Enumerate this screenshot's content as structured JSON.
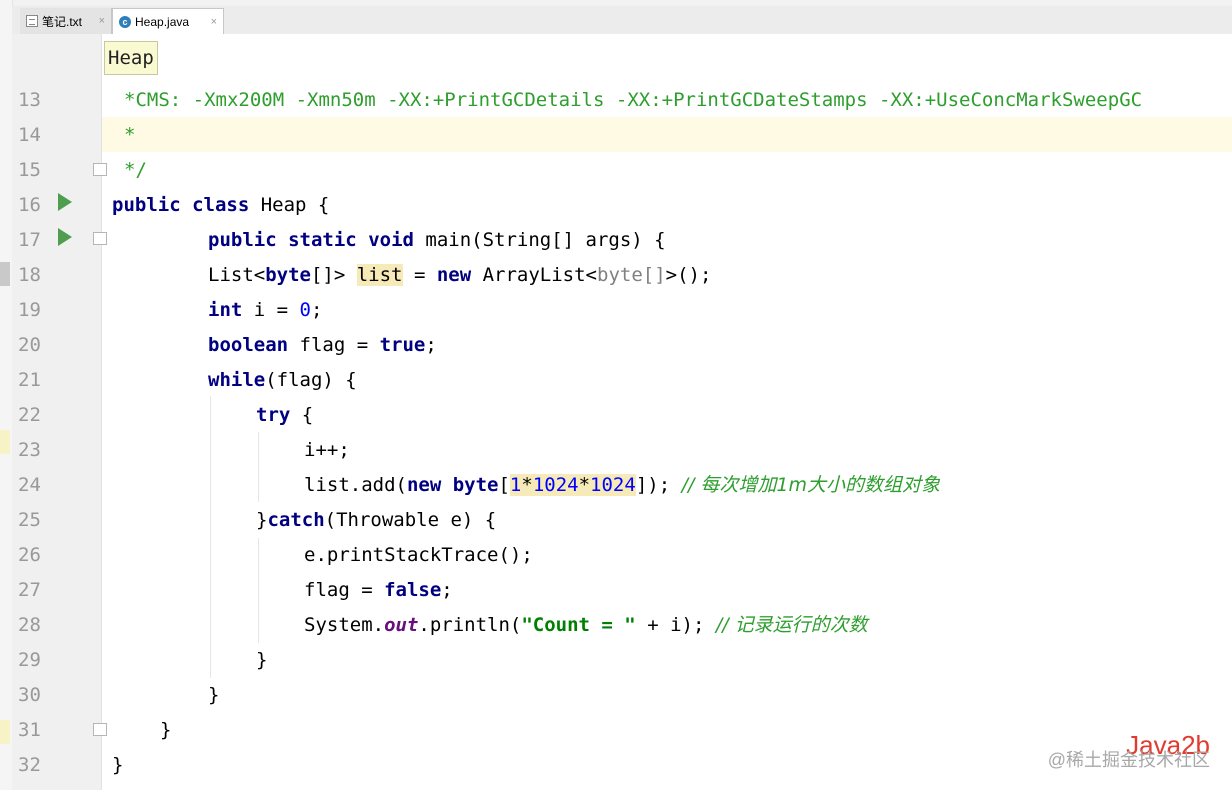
{
  "tabs": [
    {
      "label": "笔记.txt",
      "close": "×"
    },
    {
      "label": "Heap.java",
      "close": "×"
    }
  ],
  "breadcrumb": "Heap",
  "line_numbers": [
    "13",
    "14",
    "15",
    "16",
    "17",
    "18",
    "19",
    "20",
    "21",
    "22",
    "23",
    "24",
    "25",
    "26",
    "27",
    "28",
    "29",
    "30",
    "31",
    "32"
  ],
  "code": {
    "l13": "*CMS: -Xmx200M -Xmn50m -XX:+PrintGCDetails -XX:+PrintGCDateStamps -XX:+UseConcMarkSweepGC",
    "l14": "*",
    "l15": "*/",
    "l16_kw1": "public",
    "l16_kw2": "class",
    "l16_rest": " Heap {",
    "l17_kw1": "public",
    "l17_kw2": "static",
    "l17_kw3": "void",
    "l17_rest": " main(String[] args) {",
    "l18_a": "List<",
    "l18_kw": "byte",
    "l18_b": "[]> ",
    "l18_var": "list",
    "l18_c": " = ",
    "l18_kw2": "new",
    "l18_d": " ArrayList<",
    "l18_gry": "byte[]",
    "l18_e": ">();",
    "l19_kw": "int",
    "l19_a": " i = ",
    "l19_num": "0",
    "l19_b": ";",
    "l20_kw": "boolean",
    "l20_a": " flag = ",
    "l20_kw2": "true",
    "l20_b": ";",
    "l21_kw": "while",
    "l21_rest": "(flag) {",
    "l22_kw": "try",
    "l22_rest": " {",
    "l23": "i++;",
    "l24_a": "list.add(",
    "l24_kw": "new byte",
    "l24_b": "[",
    "l24_num1": "1",
    "l24_c": "*",
    "l24_num2": "1024",
    "l24_d": "*",
    "l24_num3": "1024",
    "l24_e": "]); ",
    "l24_cm": "// 每次增加1m大小的数组对象",
    "l25_a": "}",
    "l25_kw": "catch",
    "l25_rest": "(Throwable e) {",
    "l26": "e.printStackTrace();",
    "l27_a": "flag = ",
    "l27_kw": "false",
    "l27_b": ";",
    "l28_a": "System.",
    "l28_fld": "out",
    "l28_b": ".println(",
    "l28_str": "\"Count = \"",
    "l28_c": " + i); ",
    "l28_cm": "// 记录运行的次数",
    "l29": "}",
    "l30": "}",
    "l31": "}",
    "l32": "}"
  },
  "watermark": {
    "logo": "Java2b",
    "text": "@稀土掘金技术社区"
  }
}
